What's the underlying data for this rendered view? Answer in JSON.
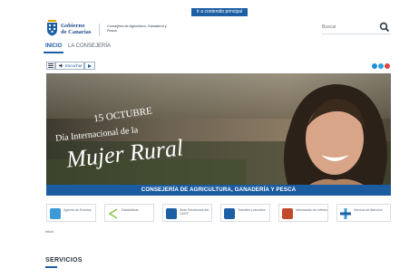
{
  "skip_link": "Ir a contenido principal",
  "header": {
    "logo_line1": "Gobierno",
    "logo_line2": "de Canarias",
    "ministry": "Consejería de Agricultura, Ganadería y Pesca"
  },
  "search": {
    "placeholder": "Buscar"
  },
  "nav": {
    "inicio": "INICIO",
    "consejeria": "LA CONSEJERÍA"
  },
  "toolbar": {
    "listen_label": "Escuchar"
  },
  "banner": {
    "date": "15 OCTUBRE",
    "subtitle": "Día Internacional de la",
    "title": "Mujer Rural",
    "footer": "CONSEJERÍA DE AGRICULTURA, GANADERÍA Y PESCA"
  },
  "quick_links": [
    {
      "label": "Agenda de Eventos",
      "color": "#3c9bd6"
    },
    {
      "label": "Estadísticas",
      "color": "#8cc63f"
    },
    {
      "label": "Sede Electrónica del CAGP",
      "color": "#1d5fa5"
    },
    {
      "label": "Trámites y servicios",
      "color": "#1d5fa5"
    },
    {
      "label": "Información de Interés",
      "color": "#c04a2b"
    },
    {
      "label": "Servicio de Atención",
      "color": "#3c9bd6"
    }
  ],
  "breadcrumb": "Inicio",
  "section_title": "SERVICIOS",
  "colors": {
    "brand": "#1d5fa5",
    "banner_bar": "#1b5ca0"
  }
}
